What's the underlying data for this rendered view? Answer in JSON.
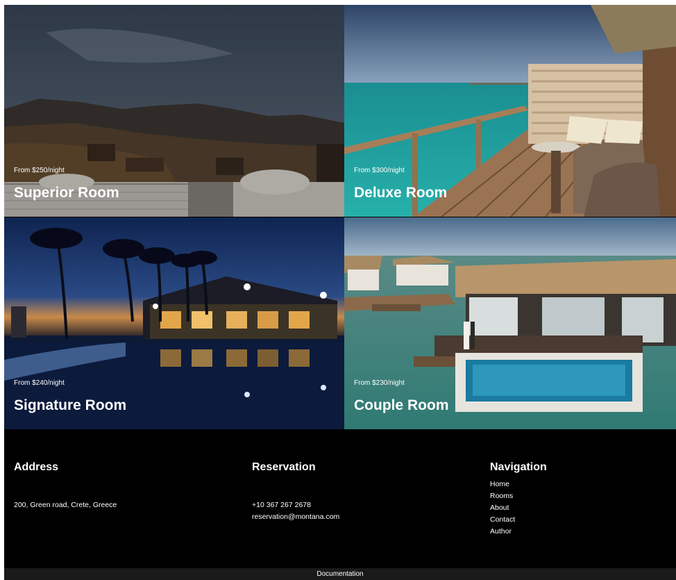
{
  "rooms": [
    {
      "price": "From $250/night",
      "name": "Superior Room"
    },
    {
      "price": "From $300/night",
      "name": "Deluxe Room"
    },
    {
      "price": "From $240/night",
      "name": "Signature Room"
    },
    {
      "price": "From $230/night",
      "name": "Couple Room"
    }
  ],
  "footer": {
    "address": {
      "heading": "Address",
      "line": "200, Green road, Crete, Greece"
    },
    "reservation": {
      "heading": "Reservation",
      "phone": "+10 367 267 2678",
      "email": "reservation@montana.com"
    },
    "navigation": {
      "heading": "Navigation",
      "links": [
        "Home",
        "Rooms",
        "About",
        "Contact",
        "Author"
      ]
    }
  },
  "bottom_link": "Documentation"
}
